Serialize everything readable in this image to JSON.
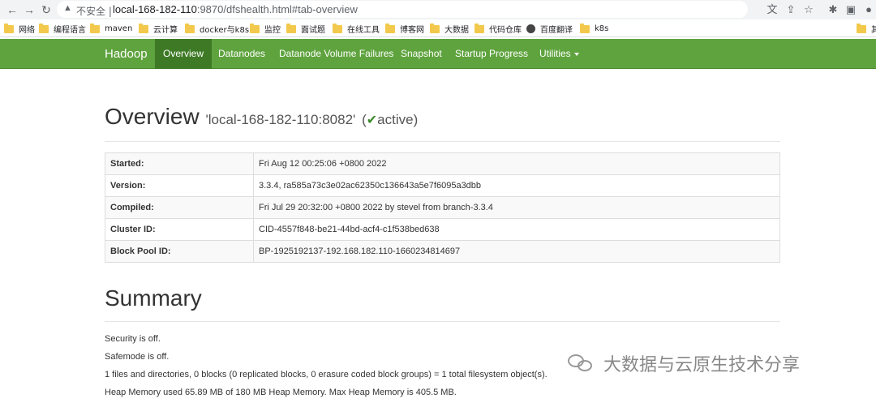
{
  "browser": {
    "warning_icon": "warning-triangle-icon",
    "not_secure": "不安全",
    "separator": "|",
    "url_host": "local-168-182-110",
    "url_rest": ":9870/dfshealth.html#tab-overview"
  },
  "bookmarks": [
    {
      "label": "网络",
      "icon": "folder"
    },
    {
      "label": "编程语言",
      "icon": "folder"
    },
    {
      "label": "maven",
      "icon": "folder"
    },
    {
      "label": "云计算",
      "icon": "folder"
    },
    {
      "label": "docker与k8s",
      "icon": "folder"
    },
    {
      "label": "监控",
      "icon": "folder"
    },
    {
      "label": "面试题",
      "icon": "folder"
    },
    {
      "label": "在线工具",
      "icon": "folder"
    },
    {
      "label": "博客网",
      "icon": "folder"
    },
    {
      "label": "大数据",
      "icon": "folder"
    },
    {
      "label": "代码仓库",
      "icon": "folder"
    },
    {
      "label": "百度翻译",
      "icon": "globe"
    },
    {
      "label": "k8s",
      "icon": "folder"
    },
    {
      "label": "其",
      "icon": "folder"
    }
  ],
  "navbar": {
    "brand": "Hadoop",
    "items": [
      "Overview",
      "Datanodes",
      "Datanode Volume Failures",
      "Snapshot",
      "Startup Progress",
      "Utilities"
    ],
    "active": "Overview",
    "bg_color": "#5fa33e",
    "active_color": "#3e7a25"
  },
  "overview": {
    "title": "Overview",
    "host": "'local-168-182-110:8082'",
    "paren_open": "(",
    "status": "active",
    "paren_close": ")",
    "rows": [
      {
        "key": "Started:",
        "value": "Fri Aug 12 00:25:06 +0800 2022"
      },
      {
        "key": "Version:",
        "value": "3.3.4, ra585a73c3e02ac62350c136643a5e7f6095a3dbb"
      },
      {
        "key": "Compiled:",
        "value": "Fri Jul 29 20:32:00 +0800 2022 by stevel from branch-3.3.4"
      },
      {
        "key": "Cluster ID:",
        "value": "CID-4557f848-be21-44bd-acf4-c1f538bed638"
      },
      {
        "key": "Block Pool ID:",
        "value": "BP-1925192137-192.168.182.110-1660234814697"
      }
    ]
  },
  "summary": {
    "title": "Summary",
    "lines": [
      "Security is off.",
      "Safemode is off.",
      "1 files and directories, 0 blocks (0 replicated blocks, 0 erasure coded block groups) = 1 total filesystem object(s).",
      "Heap Memory used 65.89 MB of 180 MB Heap Memory. Max Heap Memory is 405.5 MB."
    ]
  },
  "watermark": {
    "text": "大数据与云原生技术分享"
  }
}
